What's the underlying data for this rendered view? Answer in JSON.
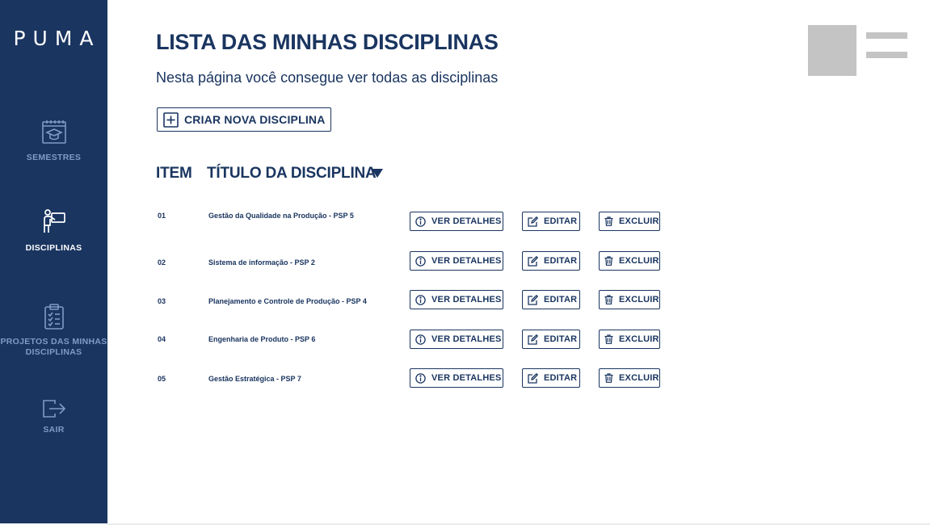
{
  "sidebar": {
    "logo": "PUMA",
    "items": [
      {
        "label": "SEMESTRES",
        "icon": "calendar-graduation-icon",
        "active": false
      },
      {
        "label": "DISCIPLINAS",
        "icon": "teacher-board-icon",
        "active": true
      },
      {
        "label": "PROJETOS DAS MINHAS DISCIPLINAS",
        "icon": "clipboard-checklist-icon",
        "active": false
      },
      {
        "label": "SAIR",
        "icon": "logout-icon",
        "active": false
      }
    ]
  },
  "header": {
    "title": "LISTA DAS MINHAS DISCIPLINAS",
    "subtitle": "Nesta página você consegue ver todas as disciplinas",
    "create_button": "CRIAR NOVA DISCIPLINA"
  },
  "table": {
    "columns": {
      "item": "ITEM",
      "title": "TÍTULO DA DISCIPLINA"
    },
    "sort_icon": "caret-down-icon",
    "actions": {
      "details": "VER DETALHES",
      "edit": "EDITAR",
      "delete": "EXCLUIR"
    },
    "rows": [
      {
        "item": "01",
        "title": "Gestão da Qualidade na Produção - PSP 5"
      },
      {
        "item": "02",
        "title": "Sistema de informação - PSP 2"
      },
      {
        "item": "03",
        "title": "Planejamento e Controle de Produção - PSP 4"
      },
      {
        "item": "04",
        "title": "Engenharia de Produto - PSP 6"
      },
      {
        "item": "05",
        "title": "Gestão Estratégica - PSP 7"
      }
    ]
  },
  "colors": {
    "primary": "#1a3560",
    "sidebar_inactive_text": "#7f9bc6",
    "placeholder": "#c4c4c4"
  }
}
